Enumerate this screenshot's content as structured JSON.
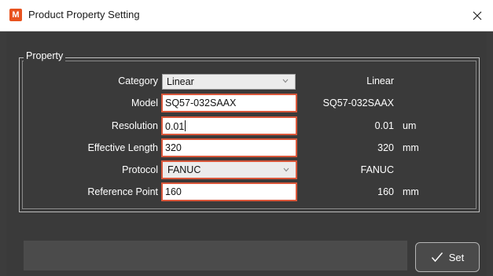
{
  "window": {
    "icon_letter": "M",
    "title": "Product Property Setting",
    "close_glyph": "✕"
  },
  "group": {
    "label": "Property"
  },
  "rows": [
    {
      "label": "Category",
      "input": "Linear",
      "readout": "Linear",
      "unit": ""
    },
    {
      "label": "Model",
      "input": "SQ57-032SAAX",
      "readout": "SQ57-032SAAX",
      "unit": ""
    },
    {
      "label": "Resolution",
      "input": "0.01",
      "readout": "0.01",
      "unit": "um"
    },
    {
      "label": "Effective Length",
      "input": "320",
      "readout": "320",
      "unit": "mm"
    },
    {
      "label": "Protocol",
      "input": "FANUC",
      "readout": "FANUC",
      "unit": ""
    },
    {
      "label": "Reference Point",
      "input": "160",
      "readout": "160",
      "unit": "mm"
    }
  ],
  "footer": {
    "status_text": "",
    "set_label": "Set",
    "set_icon": "checkmark-icon"
  },
  "colors": {
    "highlight_border": "#d9573b",
    "app_icon": "#e8531f"
  }
}
